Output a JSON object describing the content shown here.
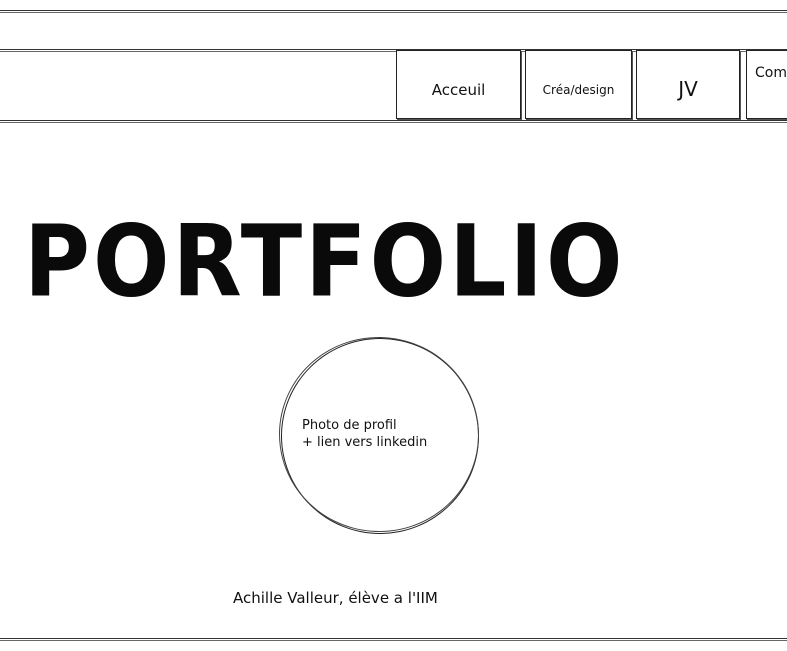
{
  "nav": {
    "items": [
      {
        "label": "Acceuil"
      },
      {
        "label": "Créa/design"
      },
      {
        "label": "JV"
      },
      {
        "label": "Com"
      }
    ]
  },
  "hero": {
    "title": "PORTFOLIO"
  },
  "profile": {
    "line1": "Photo de profil",
    "line2": "+ lien vers linkedin"
  },
  "caption": {
    "text": "Achille Valleur, élève a l'IIM"
  }
}
